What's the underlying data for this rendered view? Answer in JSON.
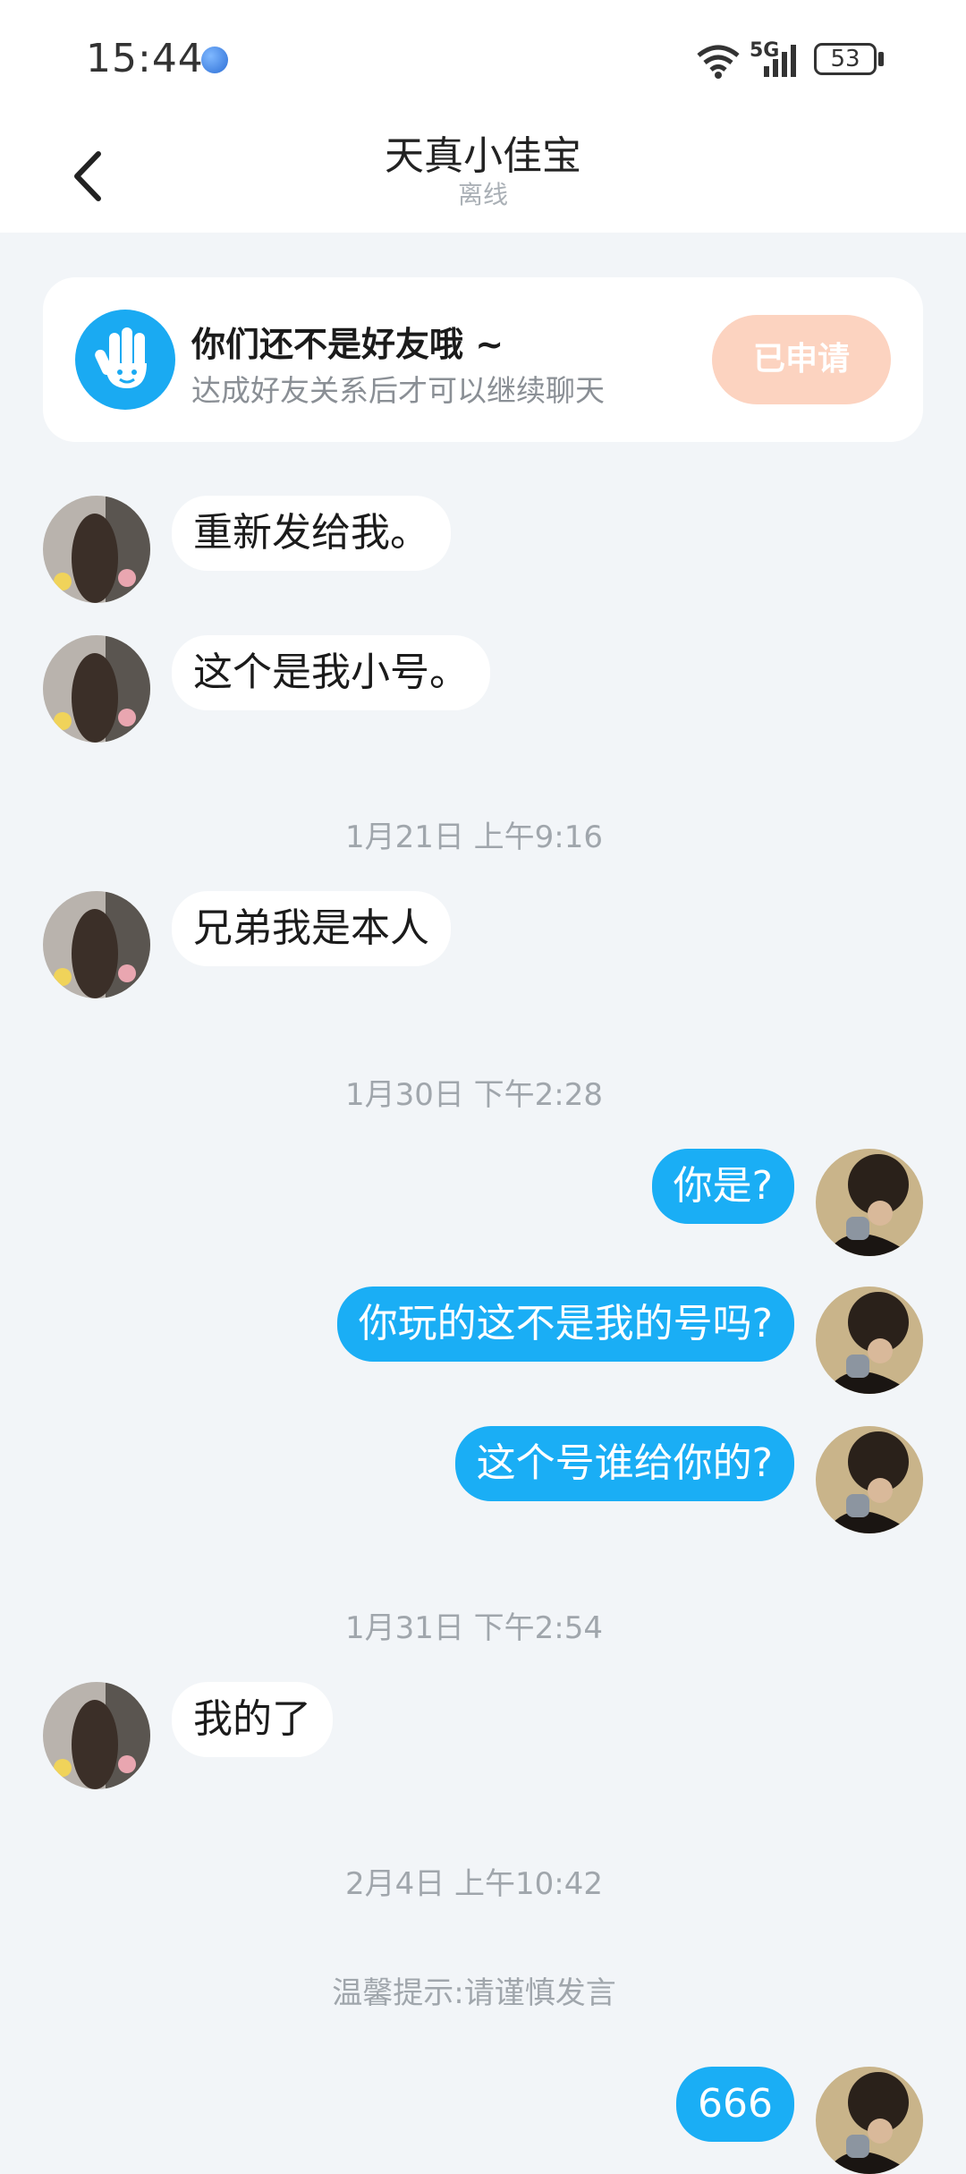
{
  "status_bar": {
    "time": "15:44",
    "network": "5G",
    "battery": "53"
  },
  "header": {
    "title": "天真小佳宝",
    "subtitle": "离线"
  },
  "notice": {
    "title": "你们还不是好友哦 ~",
    "description": "达成好友关系后才可以继续聊天",
    "button": "已申请"
  },
  "messages": [
    {
      "side": "in",
      "text": "重新发给我。"
    },
    {
      "side": "in",
      "text": "这个是我小号。"
    },
    {
      "timestamp": "1月21日 上午9:16"
    },
    {
      "side": "in",
      "text": "兄弟我是本人"
    },
    {
      "timestamp": "1月30日 下午2:28"
    },
    {
      "side": "out",
      "text": "你是?"
    },
    {
      "side": "out",
      "text": "你玩的这不是我的号吗?"
    },
    {
      "side": "out",
      "text": "这个号谁给你的?"
    },
    {
      "timestamp": "1月31日 下午2:54"
    },
    {
      "side": "in",
      "text": "我的了"
    },
    {
      "timestamp": "2月4日 上午10:42"
    },
    {
      "tip": "温馨提示:请谨慎发言"
    },
    {
      "side": "out",
      "text": "666"
    }
  ],
  "colors": {
    "accent": "#1aaef5",
    "applied_button": "#fcd3c0",
    "background": "#f2f5f8"
  }
}
